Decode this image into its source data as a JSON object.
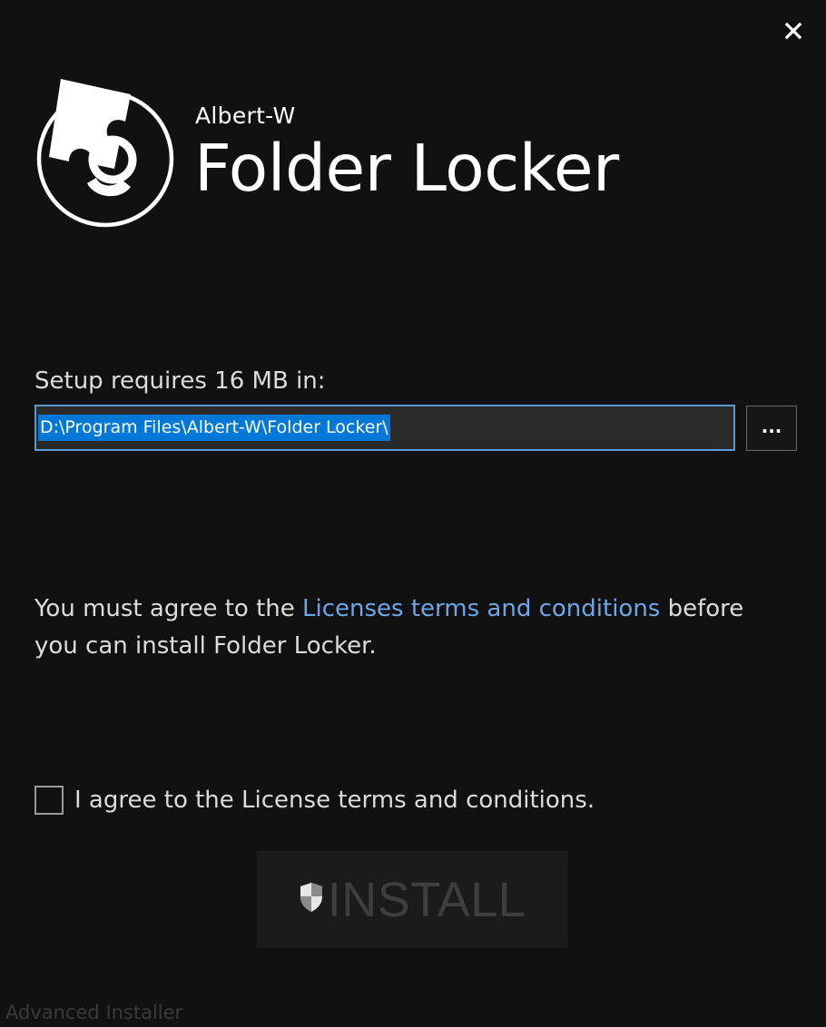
{
  "window": {
    "close_icon": "close-icon"
  },
  "brand": {
    "vendor": "Albert-W",
    "product": "Folder Locker",
    "logo_icon": "puzzle-lock-logo"
  },
  "install_location": {
    "label": "Setup requires 16 MB in:",
    "path_value": "D:\\Program Files\\Albert-W\\Folder Locker\\",
    "browse_label": "..."
  },
  "license": {
    "text_before": "You must agree to the ",
    "link_text": "Licenses terms and conditions",
    "text_after": " before you can install Folder Locker.",
    "checkbox_label": "I agree to the License terms and conditions.",
    "checked": false
  },
  "install_button": {
    "label": "INSTALL",
    "icon": "uac-shield-icon",
    "enabled": false
  },
  "footer": {
    "text": "Advanced Installer"
  },
  "colors": {
    "background": "#111112",
    "link": "#6ea6e8",
    "selection": "#0078d7",
    "input_border": "#5b9bd5"
  }
}
